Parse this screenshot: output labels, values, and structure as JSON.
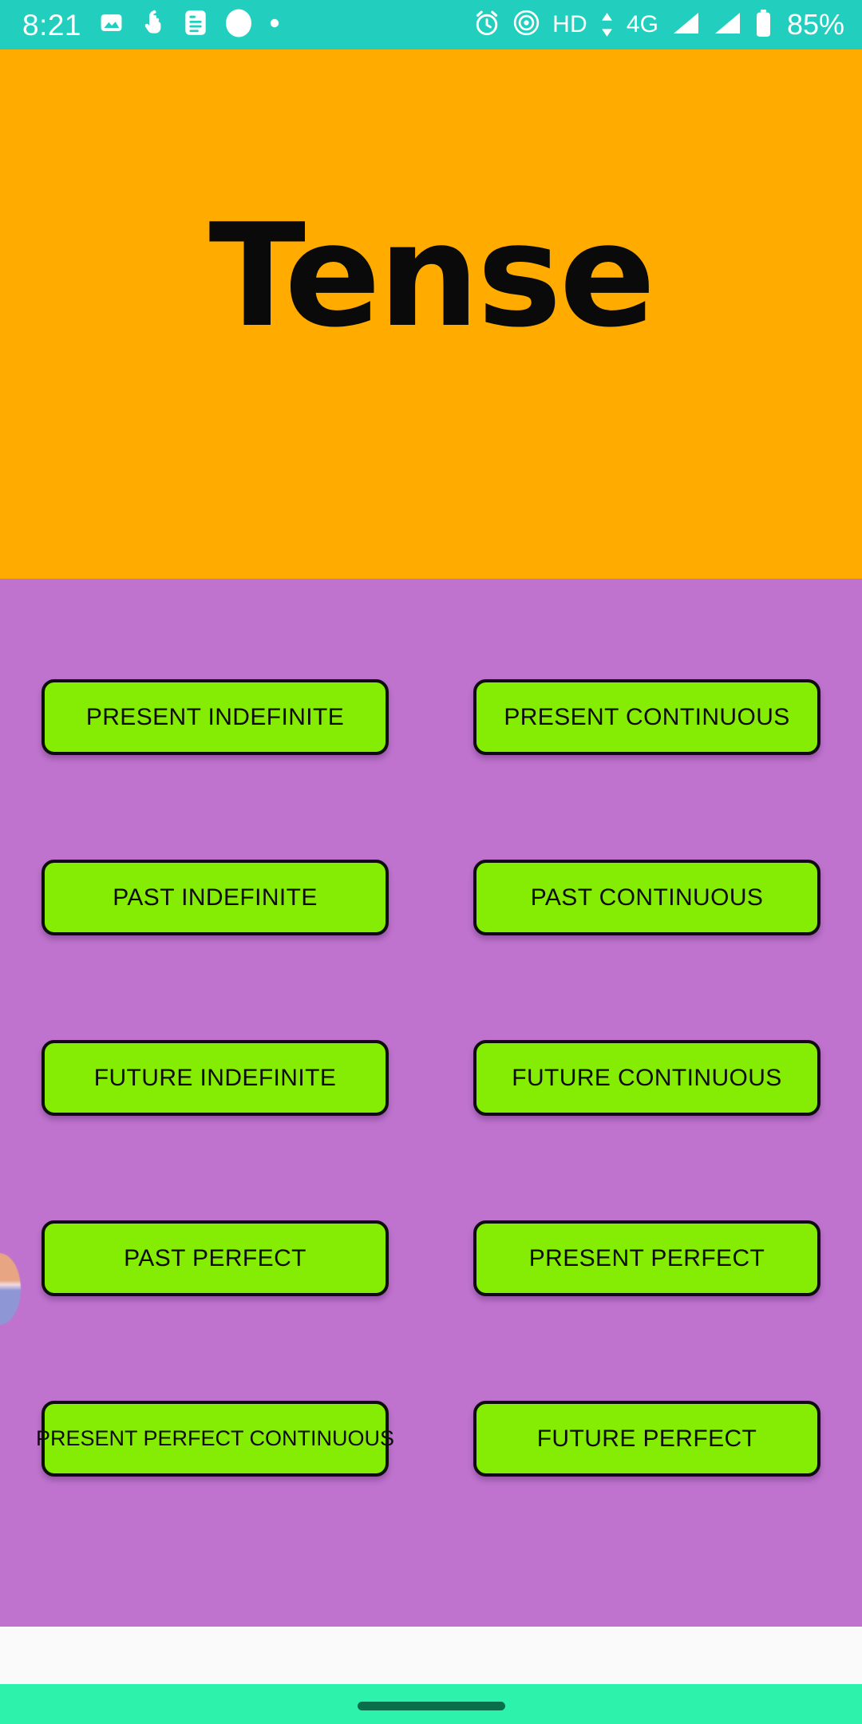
{
  "status_bar": {
    "time": "8:21",
    "background_color": "#22cfbf",
    "left_icons": [
      {
        "name": "image-icon",
        "label": "Image"
      },
      {
        "name": "touch-gesture-icon",
        "label": "Touch"
      },
      {
        "name": "document-icon",
        "label": "Document"
      },
      {
        "name": "circle-notification-icon",
        "label": "Notification"
      },
      {
        "name": "dot-icon",
        "label": "More"
      }
    ],
    "right_icons": [
      {
        "name": "alarm-clock-icon",
        "label": "Alarm"
      },
      {
        "name": "hotspot-icon",
        "label": "Hotspot"
      }
    ],
    "hd_label": "HD",
    "data_up_down": "updown-arrows-icon",
    "network_label": "4G",
    "signal_bars": 2,
    "battery_percent": "85%"
  },
  "header": {
    "title": "Tense",
    "background_color": "#ffab00",
    "title_color": "#000000"
  },
  "content": {
    "background_color": "#bf73ce",
    "avatar": {
      "name": "partial-avatar",
      "visible": true
    }
  },
  "buttons": {
    "fill_color": "#85ec03",
    "border_color": "#000000",
    "rows": [
      [
        {
          "label": "PRESENT INDEFINITE",
          "name": "button-present-indefinite"
        },
        {
          "label": "PRESENT CONTINUOUS",
          "name": "button-present-continuous"
        }
      ],
      [
        {
          "label": "PAST INDEFINITE",
          "name": "button-past-indefinite"
        },
        {
          "label": "PAST CONTINUOUS",
          "name": "button-past-continuous"
        }
      ],
      [
        {
          "label": "FUTURE INDEFINITE",
          "name": "button-future-indefinite"
        },
        {
          "label": "FUTURE CONTINUOUS",
          "name": "button-future-continuous"
        }
      ],
      [
        {
          "label": "PAST PERFECT",
          "name": "button-past-perfect"
        },
        {
          "label": "PRESENT PERFECT",
          "name": "button-present-perfect"
        }
      ],
      [
        {
          "label": "PRESENT PERFECT CONTINUOUS",
          "name": "button-present-perfect-continuous"
        },
        {
          "label": "FUTURE PERFECT",
          "name": "button-future-perfect"
        }
      ]
    ]
  },
  "nav_bar": {
    "background_color": "#2df2ab",
    "home_indicator_color": "#0a6e4a"
  }
}
